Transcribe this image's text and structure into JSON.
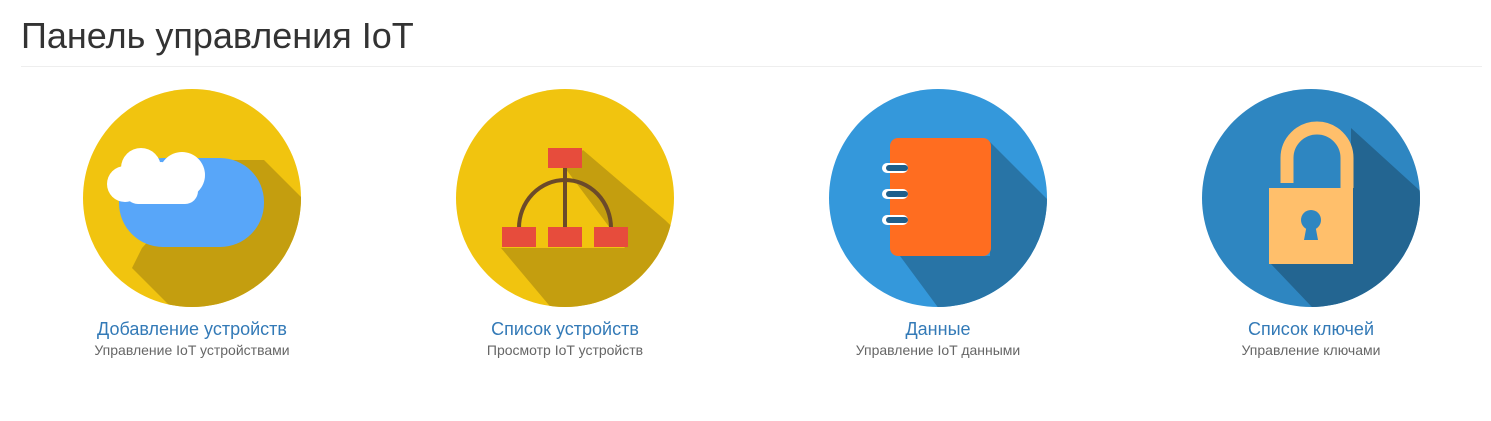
{
  "header": {
    "title": "Панель управления IoT"
  },
  "tiles": [
    {
      "label": "Добавление устройств",
      "description": "Управление IoT устройствами",
      "icon": "cloud-icon",
      "circle_color": "#f1c40f"
    },
    {
      "label": "Список устройств",
      "description": "Просмотр IoT устройств",
      "icon": "hierarchy-icon",
      "circle_color": "#f1c40f"
    },
    {
      "label": "Данные",
      "description": "Управление IoT данными",
      "icon": "notebook-icon",
      "circle_color": "#3498db"
    },
    {
      "label": "Список ключей",
      "description": "Управление ключами",
      "icon": "unlocked-padlock-icon",
      "circle_color": "#2e86c1"
    }
  ],
  "colors": {
    "link": "#337ab7",
    "description": "#666666",
    "title": "#333333"
  }
}
